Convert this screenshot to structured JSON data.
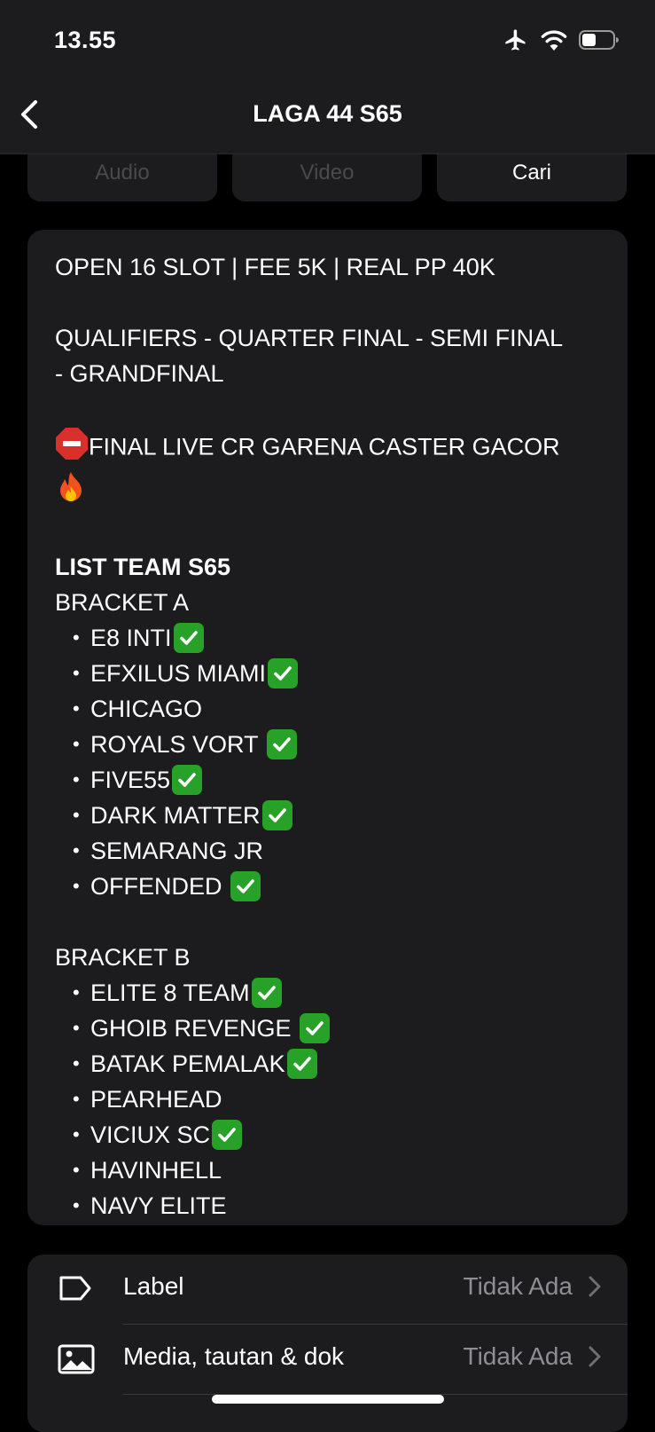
{
  "status_bar": {
    "time": "13.55"
  },
  "nav": {
    "title": "LAGA 44 S65"
  },
  "tabs": [
    {
      "label": "Audio"
    },
    {
      "label": "Video"
    },
    {
      "label": "Cari"
    }
  ],
  "description": {
    "line1": "OPEN 16 SLOT | FEE 5K | REAL PP 40K",
    "line2a": "QUALIFIERS - QUARTER FINAL - SEMI FINAL",
    "line2b": "- GRANDFINAL",
    "final_live": "FINAL LIVE CR GARENA CASTER GACOR",
    "list_title": "LIST TEAM S65",
    "bracket_a": {
      "title": "BRACKET A",
      "teams": [
        {
          "name": "E8 INTI",
          "checked": true
        },
        {
          "name": "EFXILUS MIAMI",
          "checked": true
        },
        {
          "name": "CHICAGO",
          "checked": false
        },
        {
          "name": "ROYALS VORT ",
          "checked": true
        },
        {
          "name": "FIVE55",
          "checked": true
        },
        {
          "name": "DARK MATTER",
          "checked": true
        },
        {
          "name": "SEMARANG JR",
          "checked": false
        },
        {
          "name": "OFFENDED ",
          "checked": true
        }
      ]
    },
    "bracket_b": {
      "title": "BRACKET B",
      "teams": [
        {
          "name": "ELITE 8 TEAM",
          "checked": true
        },
        {
          "name": "GHOIB REVENGE ",
          "checked": true
        },
        {
          "name": "BATAK PEMALAK",
          "checked": true
        },
        {
          "name": "PEARHEAD",
          "checked": false
        },
        {
          "name": "VICIUX SC",
          "checked": true
        },
        {
          "name": "HAVINHELL",
          "checked": false
        },
        {
          "name": "NAVY ELITE",
          "checked": false
        }
      ]
    }
  },
  "info": {
    "rows": [
      {
        "label": "Label",
        "value": "Tidak Ada",
        "icon": "tag-icon"
      },
      {
        "label": "Media, tautan & dok",
        "value": "Tidak Ada",
        "icon": "image-icon"
      }
    ]
  },
  "colors": {
    "background": "#000000",
    "card": "#1c1c1e",
    "check": "#27a127",
    "secondary_text": "#8e8e93"
  }
}
